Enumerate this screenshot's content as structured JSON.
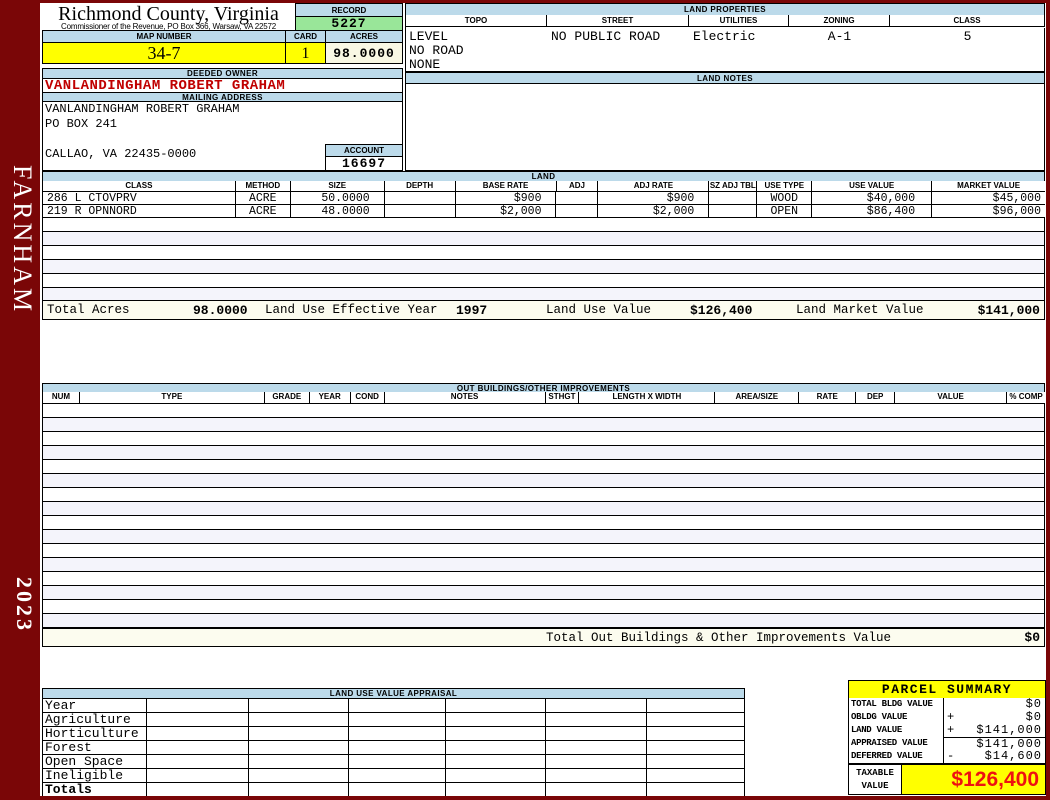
{
  "sidebar": {
    "district": "FARNHAM",
    "year": "2023"
  },
  "header": {
    "county": "Richmond County, Virginia",
    "commissioner": "Commissioner of the Revenue, PO Box 366, Warsaw, VA 22572",
    "record_label": "RECORD",
    "record_value": "5227",
    "map_number_label": "MAP NUMBER",
    "map_number_value": "34-7",
    "card_label": "CARD",
    "card_value": "1",
    "acres_label": "ACRES",
    "acres_value": "98.0000"
  },
  "owner": {
    "deeded_owner_label": "DEEDED OWNER",
    "deeded_owner": "VANLANDINGHAM ROBERT GRAHAM",
    "mailing_label": "MAILING ADDRESS",
    "mailing_lines": [
      "VANLANDINGHAM ROBERT GRAHAM",
      "PO BOX 241",
      "",
      "CALLAO, VA 22435-0000"
    ],
    "account_label": "ACCOUNT",
    "account_value": "16697"
  },
  "land_properties": {
    "title": "LAND PROPERTIES",
    "columns": [
      "TOPO",
      "STREET",
      "UTILITIES",
      "ZONING",
      "CLASS"
    ],
    "topo_values": [
      "LEVEL",
      "NO ROAD",
      "NONE"
    ],
    "street": "NO PUBLIC ROAD",
    "utilities": "Electric",
    "zoning": "A-1",
    "class": "5"
  },
  "land_notes": {
    "title": "LAND NOTES"
  },
  "land": {
    "title": "LAND",
    "columns": [
      "CLASS",
      "METHOD",
      "SIZE",
      "DEPTH",
      "BASE RATE",
      "ADJ",
      "ADJ RATE",
      "SZ ADJ TBL",
      "USE TYPE",
      "USE VALUE",
      "MARKET VALUE"
    ],
    "rows": [
      {
        "class": "286 L CTOVPRV",
        "method": "ACRE",
        "size": "50.0000",
        "depth": "",
        "base_rate": "$900",
        "adj": "",
        "adj_rate": "$900",
        "sz_adj_tbl": "",
        "use_type": "WOOD",
        "use_value": "$40,000",
        "market_value": "$45,000"
      },
      {
        "class": "219 R OPNNORD",
        "method": "ACRE",
        "size": "48.0000",
        "depth": "",
        "base_rate": "$2,000",
        "adj": "",
        "adj_rate": "$2,000",
        "sz_adj_tbl": "",
        "use_type": "OPEN",
        "use_value": "$86,400",
        "market_value": "$96,000"
      }
    ],
    "empty_row_count": 6,
    "totals": {
      "total_acres_label": "Total Acres",
      "total_acres": "98.0000",
      "effective_year_label": "Land Use Effective Year",
      "effective_year": "1997",
      "use_value_label": "Land Use Value",
      "use_value": "$126,400",
      "market_value_label": "Land Market Value",
      "market_value": "$141,000"
    }
  },
  "out_buildings": {
    "title": "OUT BUILDINGS/OTHER IMPROVEMENTS",
    "columns": [
      "NUM",
      "TYPE",
      "GRADE",
      "YEAR",
      "COND",
      "NOTES",
      "STHGT",
      "LENGTH X WIDTH",
      "AREA/SIZE",
      "RATE",
      "DEP",
      "VALUE",
      "% COMP"
    ],
    "empty_row_count": 16,
    "total_label": "Total Out Buildings & Other Improvements Value",
    "total_value": "$0"
  },
  "land_use_appraisal": {
    "title": "LAND USE VALUE APPRAISAL",
    "row_labels": [
      "Year",
      "Agriculture",
      "Horticulture",
      "Forest",
      "Open Space",
      "Ineligible",
      "Totals"
    ],
    "data_col_count": 6
  },
  "parcel_summary": {
    "title": "PARCEL SUMMARY",
    "rows": [
      {
        "label": "TOTAL BLDG VALUE",
        "op": "",
        "value": "$0"
      },
      {
        "label": "OBLDG VALUE",
        "op": "+",
        "value": "$0"
      },
      {
        "label": "LAND VALUE",
        "op": "+",
        "value": "$141,000"
      },
      {
        "label": "APPRAISED VALUE",
        "op": "",
        "value": "$141,000"
      },
      {
        "label": "DEFERRED VALUE",
        "op": "-",
        "value": "$14,600"
      }
    ],
    "taxable_label_line1": "TAXABLE",
    "taxable_label_line2": "VALUE",
    "taxable_value": "$126,400"
  },
  "colors": {
    "frame_maroon": "#7a0607",
    "header_light_blue": "#bcdaea",
    "record_green": "#99e699",
    "highlight_yellow": "#ffff00",
    "owner_red": "#c00000",
    "taxable_red": "#ee1111"
  }
}
